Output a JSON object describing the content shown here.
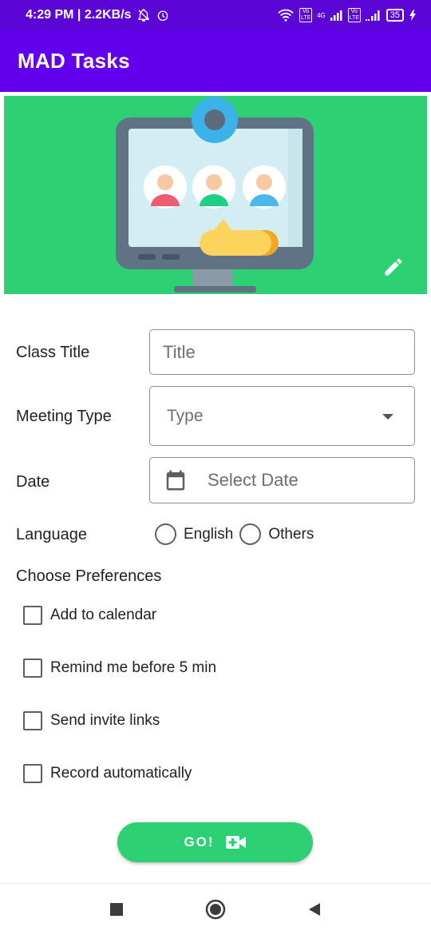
{
  "status_bar": {
    "time_speed": "4:29 PM | 2.2KB/s",
    "network_label": "4G",
    "volte1": "Vo LTE",
    "volte2": "Vo LTE",
    "battery": "35"
  },
  "app_bar": {
    "title": "MAD Tasks"
  },
  "banner": {
    "edit_icon": "pencil-icon",
    "illustration": "video-conference-monitor"
  },
  "form": {
    "class_title": {
      "label": "Class Title",
      "placeholder": "Title"
    },
    "meeting_type": {
      "label": "Meeting Type",
      "value": "Type"
    },
    "date": {
      "label": "Date",
      "placeholder": "Select Date",
      "icon": "calendar-icon"
    },
    "language": {
      "label": "Language",
      "options": [
        "English",
        "Others"
      ]
    },
    "preferences": {
      "title": "Choose Preferences",
      "items": [
        "Add to calendar",
        "Remind me before 5 min",
        "Send invite links",
        "Record automatically"
      ]
    },
    "go_button": {
      "label": "GO!",
      "icon": "video-add-icon"
    }
  },
  "colors": {
    "status_bar": "#5b06d6",
    "app_bar": "#6200ee",
    "accent_green": "#2dd073"
  }
}
